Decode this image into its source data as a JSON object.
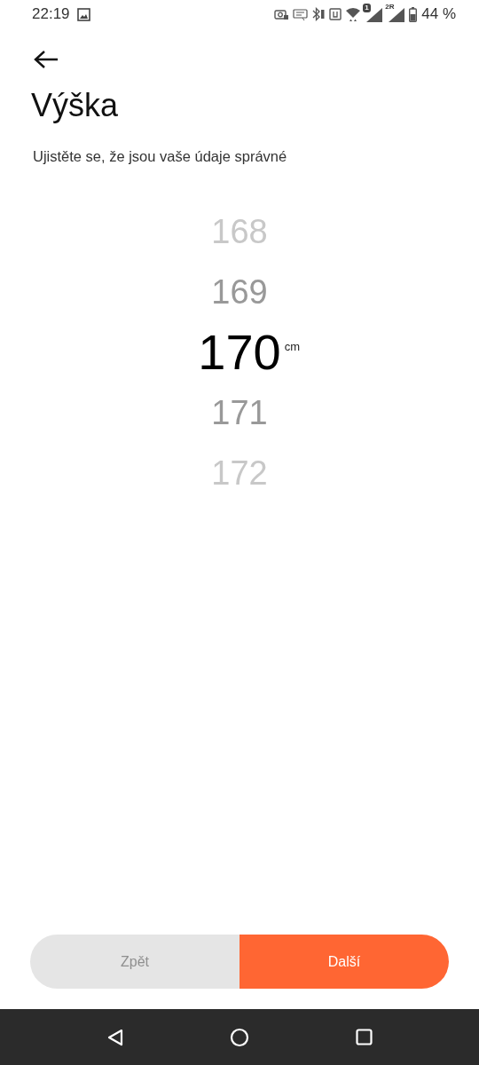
{
  "status_bar": {
    "time": "22:19",
    "sim_labels": [
      "1",
      "2R"
    ],
    "battery": "44 %"
  },
  "header": {
    "title": "Výška",
    "subtitle": "Ujistěte se, že jsou vaše údaje správné"
  },
  "picker": {
    "unit": "cm",
    "items": [
      {
        "value": "168",
        "selected": false
      },
      {
        "value": "169",
        "selected": false
      },
      {
        "value": "170",
        "selected": true
      },
      {
        "value": "171",
        "selected": false
      },
      {
        "value": "172",
        "selected": false
      }
    ]
  },
  "buttons": [
    {
      "label": "Zpět",
      "disabled": true
    },
    {
      "label": "Další",
      "disabled": false
    }
  ]
}
